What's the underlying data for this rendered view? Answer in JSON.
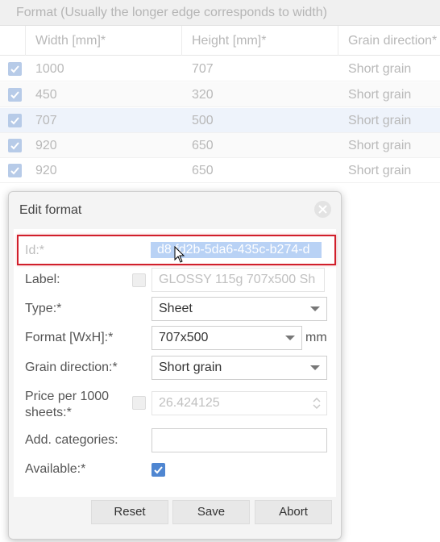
{
  "background": {
    "header": "Format (Usually the longer edge corresponds to width)",
    "columns": [
      "Width [mm]*",
      "Height [mm]*",
      "Grain direction*"
    ],
    "rows": [
      {
        "width": "1000",
        "height": "707",
        "grain": "Short grain"
      },
      {
        "width": "450",
        "height": "320",
        "grain": "Short grain"
      },
      {
        "width": "707",
        "height": "500",
        "grain": "Short grain"
      },
      {
        "width": "920",
        "height": "650",
        "grain": "Short grain"
      },
      {
        "width": "920",
        "height": "650",
        "grain": "Short grain"
      }
    ]
  },
  "dialog": {
    "title": "Edit format",
    "fields": {
      "id": {
        "label": "Id:*",
        "value": "d8 fd2b-5da6-435c-b274-d"
      },
      "label": {
        "label": "Label:",
        "value": "GLOSSY 115g 707x500 Sh"
      },
      "type": {
        "label": "Type:*",
        "value": "Sheet"
      },
      "format": {
        "label": "Format [WxH]:*",
        "value": "707x500",
        "unit": "mm"
      },
      "grain": {
        "label": "Grain direction:*",
        "value": "Short grain"
      },
      "price": {
        "label": "Price per 1000 sheets:*",
        "value": "26.424125"
      },
      "categories": {
        "label": "Add. categories:",
        "value": ""
      },
      "available": {
        "label": "Available:*",
        "checked": true
      }
    },
    "buttons": {
      "reset": "Reset",
      "save": "Save",
      "abort": "Abort"
    }
  },
  "colors": {
    "accent": "#4f86d1",
    "highlight": "#d11f2b",
    "selection": "#b9d2f5"
  }
}
